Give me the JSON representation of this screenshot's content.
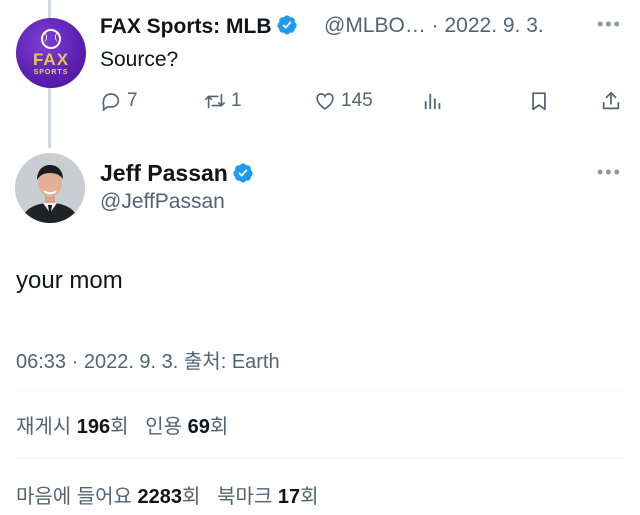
{
  "reply_tweet": {
    "author_name": "FAX Sports: MLB",
    "handle_date": "@MLBO… · 2022. 9. 3.",
    "text": "Source?",
    "avatar_text": "FAX",
    "avatar_subtext": "SPORTS",
    "actions": {
      "replies": "7",
      "retweets": "1",
      "likes": "145"
    }
  },
  "main_tweet": {
    "author_name": "Jeff Passan",
    "handle": "@JeffPassan",
    "text": "your mom",
    "meta": "06:33 · 2022. 9. 3. 출처: Earth",
    "stats": {
      "retweets_label": "재게시",
      "retweets_count": "196",
      "retweets_unit": "회",
      "quotes_label": "인용",
      "quotes_count": "69",
      "quotes_unit": "회",
      "likes_label": "마음에 들어요",
      "likes_count": "2283",
      "likes_unit": "회",
      "bookmarks_label": "북마크",
      "bookmarks_count": "17",
      "bookmarks_unit": "회"
    }
  },
  "more_glyph": "•••",
  "colors": {
    "verified": "#1d9bf0",
    "secondary_text": "#536471",
    "divider": "#eff3f4"
  }
}
